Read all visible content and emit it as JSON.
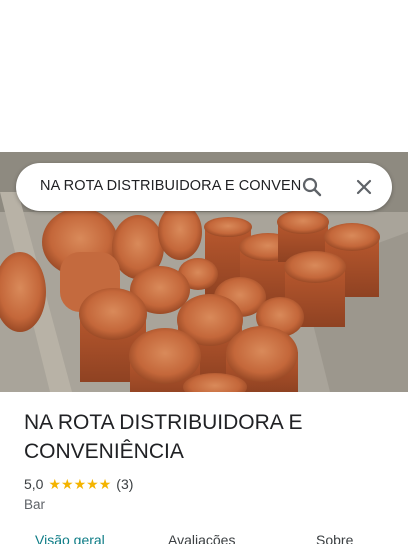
{
  "search": {
    "query": "NA ROTA DISTRIBUIDORA E CONVENIÊNCIA"
  },
  "place": {
    "name": "NA ROTA DISTRIBUIDORA E CONVENIÊNCIA",
    "rating": "5,0",
    "stars": 5,
    "review_count": "(3)",
    "category": "Bar"
  },
  "tabs": [
    {
      "label": "Visão geral",
      "active": true
    },
    {
      "label": "Avaliações",
      "active": false
    },
    {
      "label": "Sobre",
      "active": false
    }
  ],
  "colors": {
    "accent": "#0e7c86",
    "star": "#f4b400",
    "clay": "#c4673a"
  },
  "icons": {
    "search": "search-icon",
    "close": "close-icon",
    "star": "star-icon"
  }
}
